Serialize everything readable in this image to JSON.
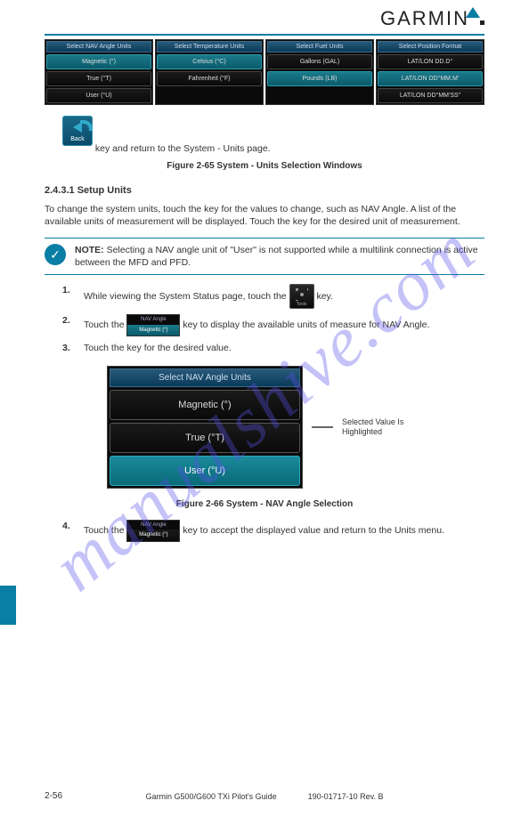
{
  "header": {
    "logo_text": "GARMIN"
  },
  "panels": [
    {
      "title": "Select NAV Angle Units",
      "options": [
        {
          "label": "Magnetic (°)",
          "selected": true
        },
        {
          "label": "True (°T)",
          "selected": false
        },
        {
          "label": "User (°U)",
          "selected": false
        }
      ]
    },
    {
      "title": "Select Temperature Units",
      "options": [
        {
          "label": "Celsius (°C)",
          "selected": true
        },
        {
          "label": "Fahrenheit (°F)",
          "selected": false
        }
      ]
    },
    {
      "title": "Select Fuel Units",
      "options": [
        {
          "label": "Gallons (GAL)",
          "selected": false
        },
        {
          "label": "Pounds (LB)",
          "selected": true
        }
      ]
    },
    {
      "title": "Select Position Format",
      "options": [
        {
          "label": "LAT/LON DD.D°",
          "selected": false
        },
        {
          "label": "LAT/LON DD°MM.M'",
          "selected": true
        },
        {
          "label": "LAT/LON DD°MM'SS\"",
          "selected": false
        }
      ]
    }
  ],
  "back_key": {
    "label": "Back"
  },
  "para1": "key and return to the System - Units page.",
  "fig1": {
    "caption": "Figure 2-65   System - Units Selection Windows"
  },
  "h2": "2.4.3.1 Setup Units",
  "para2": "To change the system units, touch the key for the values to change, such as NAV Angle. A list of the available units of measurement will be displayed. Touch the key for the desired unit of measurement.",
  "note": {
    "label": "NOTE:",
    "text": "Selecting a NAV angle unit of \"User\" is not supported while a multilink connection is active between the MFD and PFD."
  },
  "tools": {
    "label": "Tools"
  },
  "steps": {
    "s1": {
      "num": "1.",
      "text1": "While viewing the System Status page, touch the",
      "text2": "key."
    },
    "s2": {
      "num": "2.",
      "text1": "Touch the",
      "text2": "key to display the available units of measure for NAV Angle.",
      "btn_title": "NAV Angle",
      "btn_val": "Magnetic (°)"
    },
    "s3": {
      "num": "3.",
      "text": "Touch the key for the desired value."
    },
    "s4": {
      "num": "4.",
      "text1": "Touch the",
      "text2": "key to accept the displayed value and return to the Units menu.",
      "btn_title": "NAV Angle",
      "btn_val": "Magnetic (°)"
    }
  },
  "figure2": {
    "title": "Select NAV Angle Units",
    "options": [
      {
        "label": "Magnetic (°)",
        "selected": false
      },
      {
        "label": "True (°T)",
        "selected": false
      },
      {
        "label": "User (°U)",
        "selected": true
      }
    ],
    "callout": "Selected Value Is Highlighted",
    "caption": "Figure 2-66   System - NAV Angle Selection"
  },
  "footer": {
    "text": "Garmin G500/G600 TXi Pilot's Guide",
    "rev": "190-01717-10 Rev. B",
    "page": "2-56"
  },
  "watermark": "manualshive.com"
}
